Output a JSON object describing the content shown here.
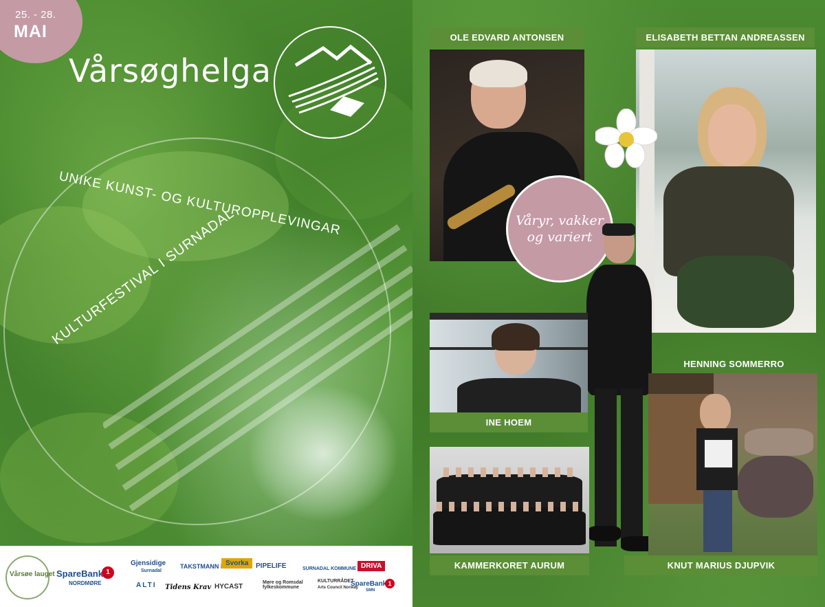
{
  "date": {
    "range": "25. - 28.",
    "month": "MAI"
  },
  "festival": {
    "name": "Vårsøghelga",
    "subtitle": "UNIKE KUNST- OG KULTUROPPLEVINGAR",
    "tagline": "KULTURFESTIVAL I SURNADAL"
  },
  "slogan": {
    "line1": "Våryr, vakker",
    "line2": "og variert"
  },
  "artists": {
    "a1": "OLE EDVARD ANTONSEN",
    "a2": "ELISABETH BETTAN ANDREASSEN",
    "a3": "INE HOEM",
    "a4": "HENNING SOMMERRO",
    "a5": "KAMMERKORET AURUM",
    "a6": "KNUT MARIUS DJUPVIK"
  },
  "sponsors": {
    "varso": "Vårsøe lauget",
    "sparebank_nordmore": "SpareBank",
    "sparebank_nordmore_sub": "NORDMØRE",
    "gjensidige": "Gjensidige",
    "gjensidige_sub": "Surnadal",
    "takstmann": "TAKSTMANN BYÅS",
    "svorka": "Svorka",
    "pipelife": "PIPELIFE",
    "surnadal_kommune": "SURNADAL KOMMUNE",
    "driva": "DRIVA",
    "alti": "ALTI",
    "tidens_krav": "Tidens Krav",
    "hycast": "HYCAST",
    "more_romsdal": "Møre og Romsdal fylkeskommune",
    "kulturradet": "KULTURRÅDET",
    "kulturradet_sub": "Arts Council Norway",
    "sparebank_smn": "SpareBank",
    "sparebank_smn_sub": "SMN"
  },
  "colors": {
    "green": "#4e8f32",
    "label_green": "#5b8e36",
    "rose": "#c49aa5",
    "white": "#ffffff"
  }
}
